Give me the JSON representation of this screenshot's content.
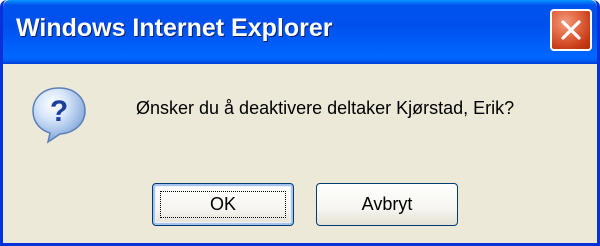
{
  "window": {
    "title": "Windows Internet Explorer",
    "close_icon": "close-x-icon"
  },
  "dialog": {
    "icon": "question-icon",
    "message": "Ønsker du å deaktivere deltaker Kjørstad, Erik?"
  },
  "buttons": {
    "ok_label": "OK",
    "cancel_label": "Avbryt"
  },
  "colors": {
    "titlebar": "#0053ee",
    "body": "#ece9d8",
    "close_button": "#e46d47",
    "button_border": "#003c74"
  }
}
